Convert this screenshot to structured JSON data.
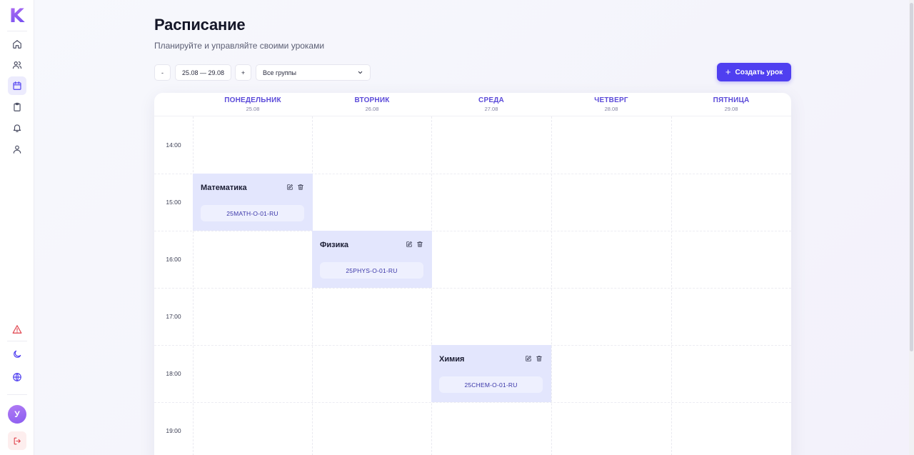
{
  "app": {
    "logo_letter": "K"
  },
  "sidebar": {
    "nav": [
      {
        "icon": "home-icon",
        "active": false
      },
      {
        "icon": "users-icon",
        "active": false
      },
      {
        "icon": "calendar-icon",
        "active": true
      },
      {
        "icon": "clipboard-icon",
        "active": false
      },
      {
        "icon": "bell-icon",
        "active": false
      },
      {
        "icon": "user-icon",
        "active": false
      }
    ],
    "bottom": [
      {
        "icon": "warning-icon"
      },
      {
        "icon": "moon-icon"
      },
      {
        "icon": "globe-icon"
      }
    ],
    "avatar_letter": "У"
  },
  "header": {
    "title": "Расписание",
    "subtitle": "Планируйте и управляйте своими уроками"
  },
  "controls": {
    "prev_label": "-",
    "date_range": "25.08 — 29.08",
    "next_label": "+",
    "group_select": "Все группы",
    "create_label": "Создать урок"
  },
  "calendar": {
    "days": [
      {
        "name": "ПОНЕДЕЛЬНИК",
        "date": "25.08"
      },
      {
        "name": "ВТОРНИК",
        "date": "26.08"
      },
      {
        "name": "СРЕДА",
        "date": "27.08"
      },
      {
        "name": "ЧЕТВЕРГ",
        "date": "28.08"
      },
      {
        "name": "ПЯТНИЦА",
        "date": "29.08"
      }
    ],
    "times": [
      "14:00",
      "15:00",
      "16:00",
      "17:00",
      "18:00",
      "19:00"
    ],
    "lessons": [
      {
        "title": "Математика",
        "group": "25MATH-O-01-RU",
        "day": 0,
        "slot": 1
      },
      {
        "title": "Физика",
        "group": "25PHYS-O-01-RU",
        "day": 1,
        "slot": 2
      },
      {
        "title": "Химия",
        "group": "25CHEM-O-01-RU",
        "day": 2,
        "slot": 4
      }
    ]
  },
  "colors": {
    "accent": "#4f3ff0",
    "lesson_bg": "#e3e6fd",
    "day_header": "#5b4ad9"
  }
}
